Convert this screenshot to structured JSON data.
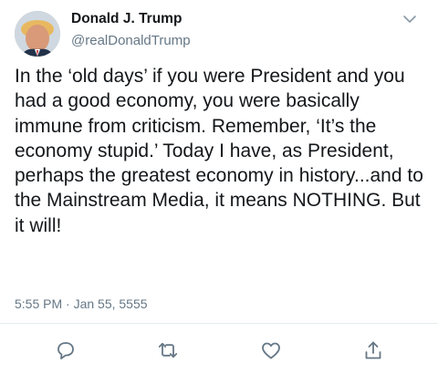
{
  "author": {
    "name": "Donald J. Trump",
    "handle": "@realDonaldTrump"
  },
  "tweet": {
    "text": "In the ‘old days’ if you were President and you had a good economy, you were basically immune from criticism. Remember, ‘It’s the economy stupid.’ Today I have, as President, perhaps the greatest economy in history...and to the Mainstream Media, it means NOTHING. But it will!",
    "timestamp": "5:55 PM · Jan 55, 5555"
  },
  "icons": {
    "menu": "chevron-down-icon",
    "reply": "reply-icon",
    "retweet": "retweet-icon",
    "like": "heart-icon",
    "share": "share-icon"
  },
  "colors": {
    "text": "#14171a",
    "secondary": "#657786",
    "divider": "#e6ecf0"
  }
}
